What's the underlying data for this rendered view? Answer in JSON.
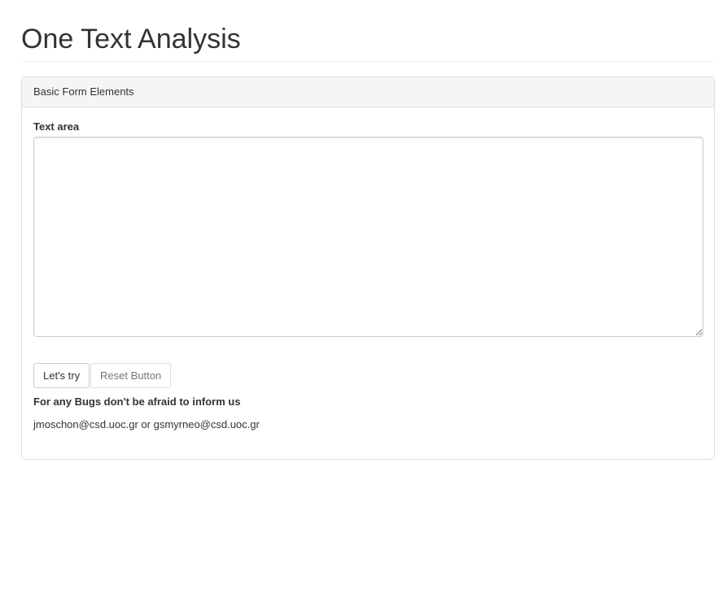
{
  "page": {
    "title": "One Text Analysis"
  },
  "panel": {
    "heading": "Basic Form Elements",
    "textarea_label": "Text area",
    "textarea_value": "",
    "buttons": {
      "try_label": "Let's try",
      "reset_label": "Reset Button"
    },
    "bug_notice": "For any Bugs don't be afraid to inform us",
    "contact": "jmoschon@csd.uoc.gr or gsmyrneo@csd.uoc.gr"
  }
}
